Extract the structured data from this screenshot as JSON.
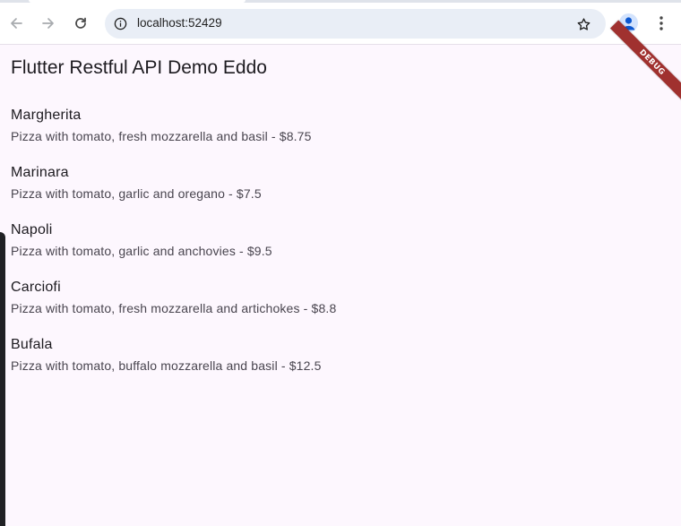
{
  "browser": {
    "url": "localhost:52429",
    "icons": {
      "back": "arrow-back-icon",
      "forward": "arrow-forward-icon",
      "reload": "reload-icon",
      "site_info": "info-icon",
      "bookmark": "star-icon",
      "profile": "profile-icon",
      "menu": "kebab-menu-icon"
    }
  },
  "app": {
    "title": "Flutter Restful API Demo Eddo",
    "debug_banner": "DEBUG",
    "pizzas": [
      {
        "name": "Margherita",
        "description": "Pizza with tomato, fresh mozzarella and basil - $8.75"
      },
      {
        "name": "Marinara",
        "description": "Pizza with tomato, garlic and oregano - $7.5"
      },
      {
        "name": "Napoli",
        "description": "Pizza with tomato, garlic and anchovies - $9.5"
      },
      {
        "name": "Carciofi",
        "description": "Pizza with tomato, fresh mozzarella and artichokes - $8.8"
      },
      {
        "name": "Bufala",
        "description": "Pizza with tomato, buffalo mozzarella and basil - $12.5"
      }
    ]
  },
  "colors": {
    "background": "#fdf7fe",
    "debug_banner": "#a0312f",
    "omnibox": "#e9eef6"
  }
}
